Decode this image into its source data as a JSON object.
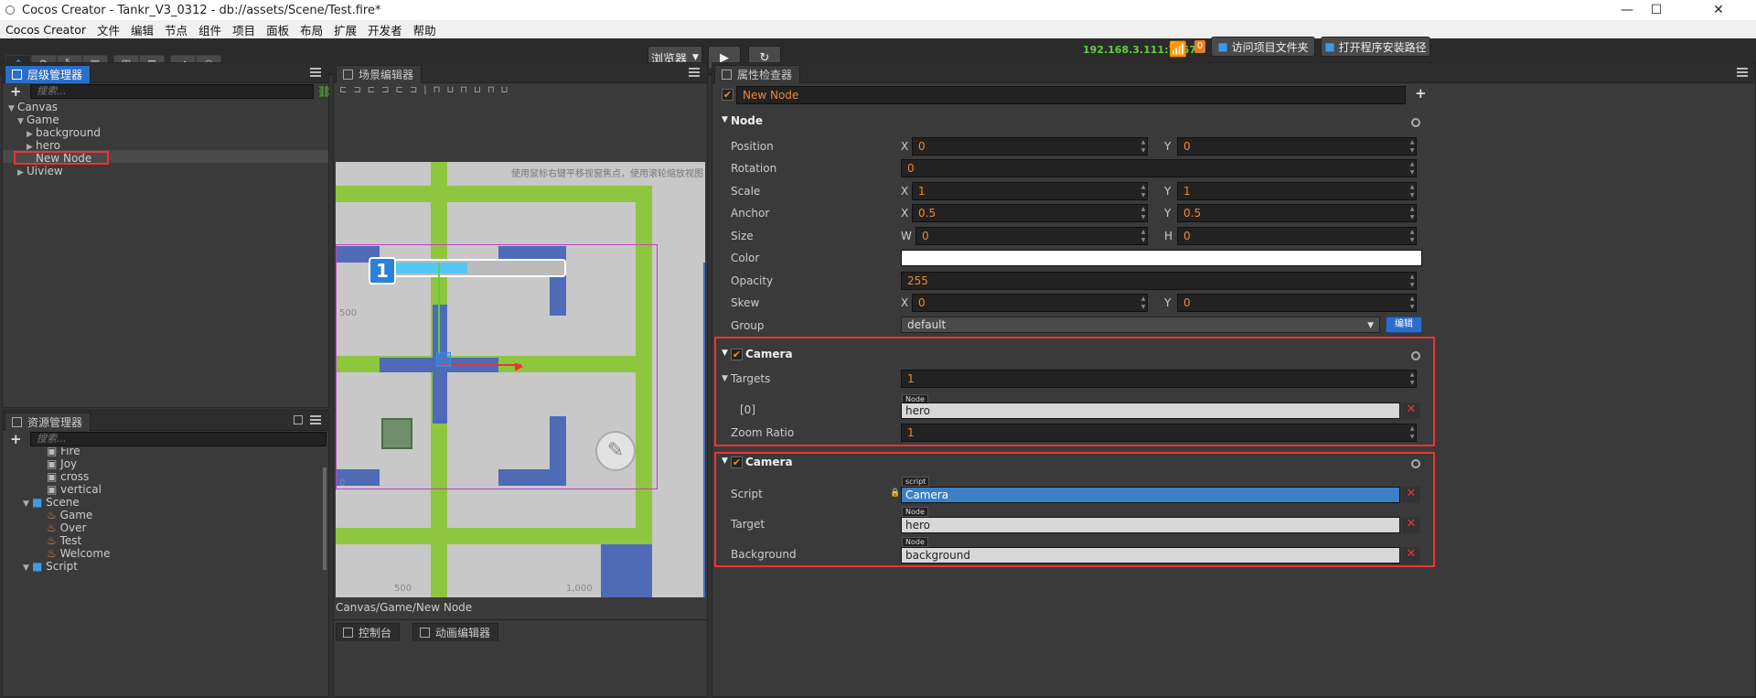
{
  "window": {
    "title": "Cocos Creator - Tankr_V3_0312 - db://assets/Scene/Test.fire*",
    "minimize": "—",
    "maximize": "☐",
    "close": "✕"
  },
  "menubar": [
    "Cocos Creator",
    "文件",
    "编辑",
    "节点",
    "组件",
    "项目",
    "面板",
    "布局",
    "扩展",
    "开发者",
    "帮助"
  ],
  "toolbar": {
    "preview_select": "浏览器",
    "ip_address": "192.168.3.111:7457",
    "notification_count": "0",
    "open_project_folder": "访问项目文件夹",
    "open_install_path": "打开程序安装路径"
  },
  "hierarchy": {
    "tab": "层级管理器",
    "search_placeholder": "搜索...",
    "nodes": [
      "Canvas",
      "Game",
      "background",
      "hero",
      "New Node",
      "Uiview"
    ]
  },
  "assets": {
    "tab": "资源管理器",
    "search_placeholder": "搜索...",
    "items": [
      "Fire",
      "Joy",
      "cross",
      "vertical",
      "Scene",
      "Game",
      "Over",
      "Test",
      "Welcome",
      "Script"
    ]
  },
  "scene": {
    "tab": "场景编辑器",
    "hint": "使用鼠标右键平移视窗焦点，使用滚轮缩放视图",
    "breadcrumb": "Canvas/Game/New Node",
    "axis_labels": [
      "500",
      "0",
      "500",
      "1,000"
    ],
    "hud_number": "1",
    "bottom_tabs": [
      "控制台",
      "动画编辑器"
    ]
  },
  "inspector": {
    "tab": "属性检查器",
    "node_name": "New Node",
    "node_section": "Node",
    "position": {
      "label": "Position",
      "x": "0",
      "y": "0"
    },
    "rotation": {
      "label": "Rotation",
      "value": "0"
    },
    "scale": {
      "label": "Scale",
      "x": "1",
      "y": "1"
    },
    "anchor": {
      "label": "Anchor",
      "x": "0.5",
      "y": "0.5"
    },
    "size": {
      "label": "Size",
      "w": "0",
      "h": "0"
    },
    "color": {
      "label": "Color"
    },
    "opacity": {
      "label": "Opacity",
      "value": "255"
    },
    "skew": {
      "label": "Skew",
      "x": "0",
      "y": "0"
    },
    "group": {
      "label": "Group",
      "value": "default",
      "edit": "编辑"
    },
    "axis": {
      "x": "X",
      "y": "Y",
      "w": "W",
      "h": "H"
    },
    "camera1": {
      "title": "Camera",
      "targets_label": "Targets",
      "targets_count": "1",
      "target0_index": "[0]",
      "target0_tag": "Node",
      "target0_value": "hero",
      "zoom_label": "Zoom Ratio",
      "zoom_value": "1"
    },
    "camera2": {
      "title": "Camera",
      "script_label": "Script",
      "script_tag": "script",
      "script_value": "Camera",
      "target_label": "Target",
      "target_tag": "Node",
      "target_value": "hero",
      "background_label": "Background",
      "background_tag": "Node",
      "background_value": "background"
    }
  }
}
